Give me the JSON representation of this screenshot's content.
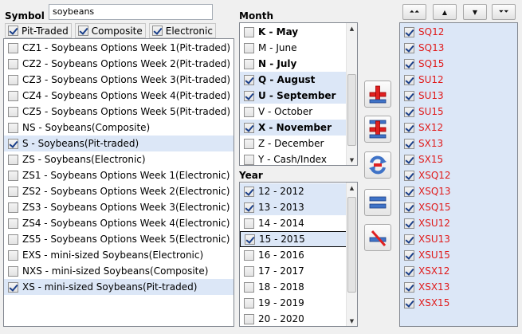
{
  "symbol": {
    "label": "Symbol",
    "search_value": "soybeans",
    "filters": [
      {
        "label": "Pit-Traded",
        "checked": true
      },
      {
        "label": "Composite",
        "checked": true
      },
      {
        "label": "Electronic",
        "checked": true
      }
    ],
    "items": [
      {
        "label": "CZ1 - Soybeans Options Week 1(Pit-traded)",
        "checked": false,
        "selected": false
      },
      {
        "label": "CZ2 - Soybeans Options Week 2(Pit-traded)",
        "checked": false,
        "selected": false
      },
      {
        "label": "CZ3 - Soybeans Options Week 3(Pit-traded)",
        "checked": false,
        "selected": false
      },
      {
        "label": "CZ4 - Soybeans Options Week 4(Pit-traded)",
        "checked": false,
        "selected": false
      },
      {
        "label": "CZ5 - Soybeans Options Week 5(Pit-traded)",
        "checked": false,
        "selected": false
      },
      {
        "label": "NS - Soybeans(Composite)",
        "checked": false,
        "selected": false
      },
      {
        "label": "S - Soybeans(Pit-traded)",
        "checked": true,
        "selected": true
      },
      {
        "label": "ZS - Soybeans(Electronic)",
        "checked": false,
        "selected": false
      },
      {
        "label": "ZS1 - Soybeans Options Week 1(Electronic)",
        "checked": false,
        "selected": false
      },
      {
        "label": "ZS2 - Soybeans Options Week 2(Electronic)",
        "checked": false,
        "selected": false
      },
      {
        "label": "ZS3 - Soybeans Options Week 3(Electronic)",
        "checked": false,
        "selected": false
      },
      {
        "label": "ZS4 - Soybeans Options Week 4(Electronic)",
        "checked": false,
        "selected": false
      },
      {
        "label": "ZS5 - Soybeans Options Week 5(Electronic)",
        "checked": false,
        "selected": false
      },
      {
        "label": "EXS - mini-sized Soybeans(Electronic)",
        "checked": false,
        "selected": false
      },
      {
        "label": "NXS - mini-sized Soybeans(Composite)",
        "checked": false,
        "selected": false
      },
      {
        "label": "XS - mini-sized Soybeans(Pit-traded)",
        "checked": true,
        "selected": true
      }
    ]
  },
  "month": {
    "label": "Month",
    "items": [
      {
        "label": "K - May",
        "checked": false,
        "bold": true,
        "selected": false
      },
      {
        "label": "M - June",
        "checked": false,
        "bold": false,
        "selected": false
      },
      {
        "label": "N - July",
        "checked": false,
        "bold": true,
        "selected": false
      },
      {
        "label": "Q - August",
        "checked": true,
        "bold": true,
        "selected": true
      },
      {
        "label": "U - September",
        "checked": true,
        "bold": true,
        "selected": true
      },
      {
        "label": "V - October",
        "checked": false,
        "bold": false,
        "selected": false
      },
      {
        "label": "X - November",
        "checked": true,
        "bold": true,
        "selected": true
      },
      {
        "label": "Z - December",
        "checked": false,
        "bold": false,
        "selected": false
      },
      {
        "label": "Y - Cash/Index",
        "checked": false,
        "bold": false,
        "selected": false
      }
    ]
  },
  "year": {
    "label": "Year",
    "items": [
      {
        "label": "12 - 2012",
        "checked": true,
        "selected": true,
        "focus": false
      },
      {
        "label": "13 - 2013",
        "checked": true,
        "selected": true,
        "focus": false
      },
      {
        "label": "14 - 2014",
        "checked": false,
        "selected": false,
        "focus": false
      },
      {
        "label": "15 - 2015",
        "checked": true,
        "selected": true,
        "focus": true
      },
      {
        "label": "16 - 2016",
        "checked": false,
        "selected": false,
        "focus": false
      },
      {
        "label": "17 - 2017",
        "checked": false,
        "selected": false,
        "focus": false
      },
      {
        "label": "18 - 2018",
        "checked": false,
        "selected": false,
        "focus": false
      },
      {
        "label": "19 - 2019",
        "checked": false,
        "selected": false,
        "focus": false
      },
      {
        "label": "20 - 2020",
        "checked": false,
        "selected": false,
        "focus": false
      }
    ]
  },
  "actions": [
    {
      "name": "add-icon"
    },
    {
      "name": "add-all-icon"
    },
    {
      "name": "replace-icon"
    },
    {
      "name": "remove-all-icon"
    },
    {
      "name": "remove-icon"
    }
  ],
  "nav_buttons": [
    {
      "name": "move-top-button",
      "glyph": "⏶⏶"
    },
    {
      "name": "move-up-button",
      "glyph": "▲"
    },
    {
      "name": "move-down-button",
      "glyph": "▼"
    },
    {
      "name": "move-bottom-button",
      "glyph": "⏷⏷"
    }
  ],
  "selected_symbols": [
    "SQ12",
    "SQ13",
    "SQ15",
    "SU12",
    "SU13",
    "SU15",
    "SX12",
    "SX13",
    "SX15",
    "XSQ12",
    "XSQ13",
    "XSQ15",
    "XSU12",
    "XSU13",
    "XSU15",
    "XSX12",
    "XSX13",
    "XSX15"
  ],
  "colors": {
    "accent_red": "#e01a1a",
    "selection": "#dce7f7"
  }
}
